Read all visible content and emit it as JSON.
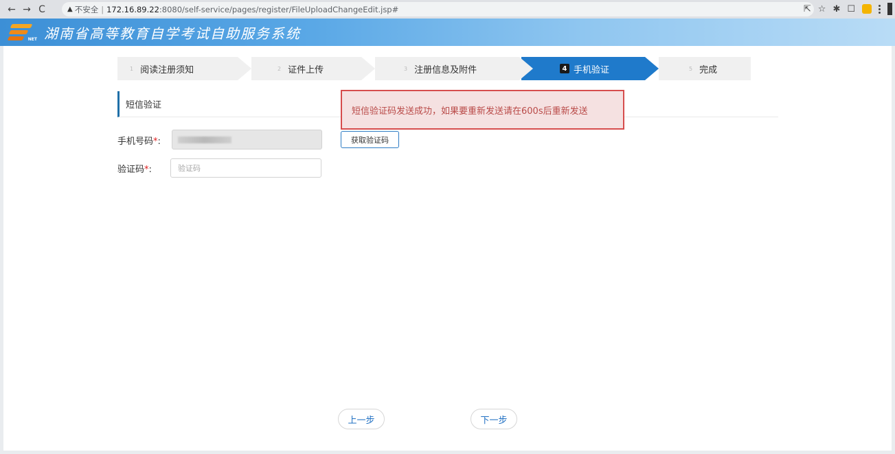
{
  "browser": {
    "back": "←",
    "forward": "→",
    "reload": "C",
    "security_warning": "▲",
    "security_label": "不安全",
    "url_separator": "|",
    "url_host": "172.16.89.22",
    "url_path": ":8080/self-service/pages/register/FileUploadChangeEdit.jsp#",
    "icons": [
      "share-icon",
      "star-icon",
      "extensions-icon",
      "sidebar-icon",
      "profile-icon",
      "menu-icon"
    ]
  },
  "header": {
    "title": "湖南省高等教育自学考试自助服务系统",
    "logo_tag": "NET"
  },
  "steps": [
    {
      "num": "1",
      "label": "阅读注册须知",
      "active": false
    },
    {
      "num": "2",
      "label": "证件上传",
      "active": false
    },
    {
      "num": "3",
      "label": "注册信息及附件",
      "active": false
    },
    {
      "num": "4",
      "label": "手机验证",
      "active": true
    },
    {
      "num": "5",
      "label": "完成",
      "active": false
    }
  ],
  "section": {
    "title": "短信验证"
  },
  "alert": {
    "message": "短信验证码发送成功，如果要重新发送请在600s后重新发送"
  },
  "form": {
    "phone_label": "手机号码",
    "code_label": "验证码",
    "required_mark": "*",
    "colon": ":",
    "code_placeholder": "验证码",
    "get_code_label": "获取验证码"
  },
  "buttons": {
    "prev": "上一步",
    "next": "下一步"
  },
  "colors": {
    "active_step": "#1f7acb",
    "alert_border": "#d64c4c",
    "alert_text": "#b94a48",
    "accent": "#1f6fa8"
  }
}
